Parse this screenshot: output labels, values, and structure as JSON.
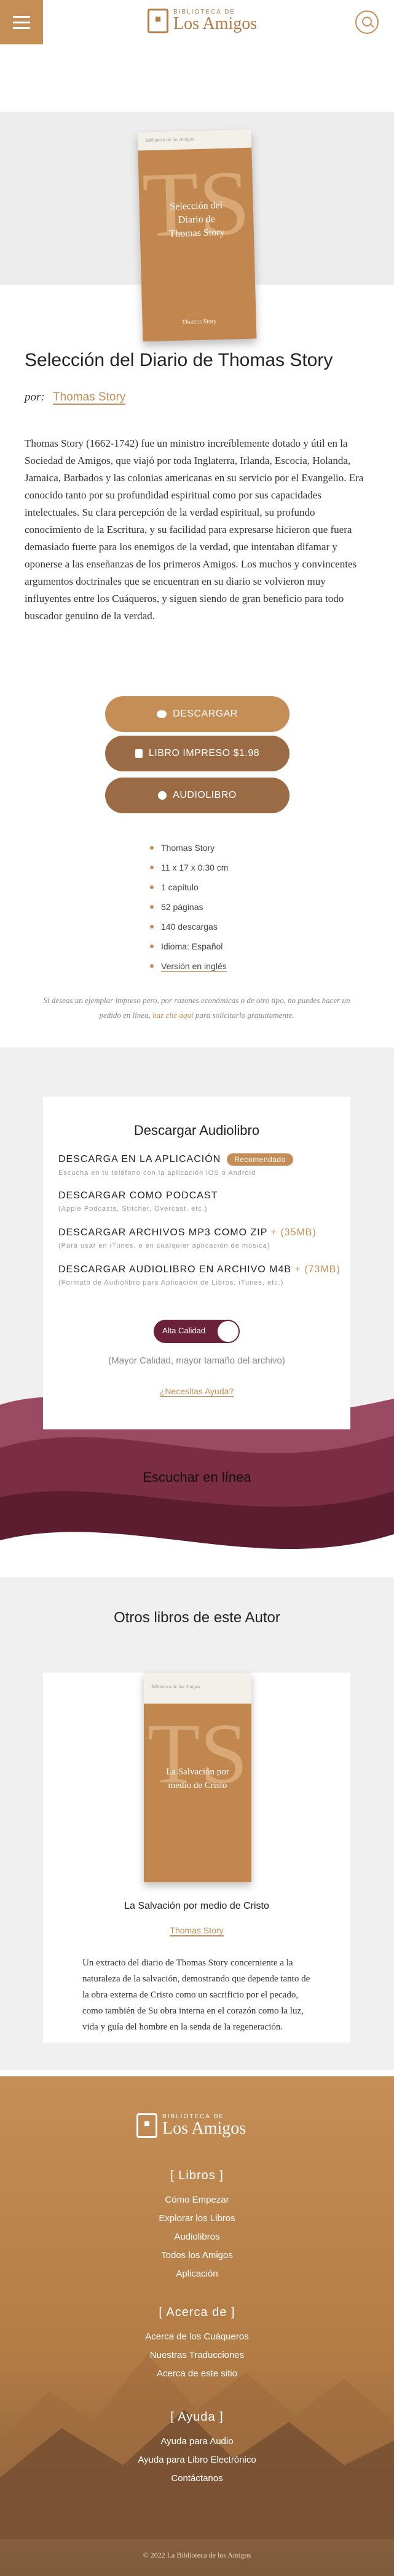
{
  "header": {
    "logo_small": "BIBLIOTECA DE",
    "logo_big": "Los Amigos",
    "menu_icon": "menu-icon",
    "search_icon": "search-icon"
  },
  "cover": {
    "top_label": "Biblioteca de los Amigos",
    "initials": "TS",
    "title_lines": [
      "Selección del",
      "Diario de",
      "Thomas Story"
    ],
    "author": "Thomas Story"
  },
  "book": {
    "title": "Selección del Diario de Thomas Story",
    "por": "por:",
    "author": "Thomas Story",
    "description": "Thomas Story (1662-1742) fue un ministro increíblemente dotado y útil en la Sociedad de Amigos, que viajó por toda Inglaterra, Irlanda, Escocia, Holanda, Jamaica, Barbados y las colonias americanas en su servicio por el Evangelio. Era conocido tanto por su profundidad espiritual como por sus capacidades intelectuales. Su clara percepción de la verdad espiritual, su profundo conocimiento de la Escritura, y su facilidad para expresarse hicieron que fuera demasiado fuerte para los enemigos de la verdad, que intentaban difamar y oponerse a las enseñanzas de los primeros Amigos. Los muchos y convincentes argumentos doctrinales que se encuentran en su diario se volvieron muy influyentes entre los Cuáqueros, y siguen siendo de gran beneficio para todo buscador genuino de la verdad."
  },
  "buttons": {
    "download": "DESCARGAR",
    "print": "LIBRO IMPRESO $1.98",
    "audio": "AUDIOLIBRO"
  },
  "details": [
    "Thomas Story",
    "11 x 17 x 0.30 cm",
    "1 capítulo",
    "52 páginas",
    "140 descargas",
    "Idioma: Español",
    "Versión en inglés"
  ],
  "note": {
    "text_a": "Si deseas un ejemplar impreso pero, por razones económicas o de otro tipo, no puedes hacer un pedido en línea,",
    "link": "haz clic aquí",
    "text_b": "para solicitarlo gratuitamente."
  },
  "audio": {
    "title": "Descargar Audiolibro",
    "options": [
      {
        "label": "DESCARGA EN LA APLICACIÓN",
        "badge": "Recomendado",
        "size": "",
        "sub": "Escucha en tu teléfono con la aplicación iOS o Android"
      },
      {
        "label": "DESCARGAR COMO PODCAST",
        "badge": "",
        "size": "",
        "sub": "(Apple Podcasts, Stitcher, Overcast, etc.)"
      },
      {
        "label": "DESCARGAR ARCHIVOS MP3 COMO ZIP",
        "badge": "",
        "size": "+ (35MB)",
        "sub": "(Para usar en iTunes, o en cualquier aplicación de música)"
      },
      {
        "label": "DESCARGAR AUDIOLIBRO EN ARCHIVO M4B",
        "badge": "",
        "size": "+ (73MB)",
        "sub": "(Formato de Audiolibro para Aplicación de Libros, iTunes, etc.)"
      }
    ],
    "toggle_label": "Alta Calidad",
    "quality_note": "(Mayor Calidad, mayor tamaño del archivo)",
    "help": "¿Necesitas Ayuda?"
  },
  "listen": "Escuchar en línea",
  "other": {
    "title": "La Salvación por medio de Cristo",
    "book_title_lines": [
      "La Salvación por",
      "medio de Cristo"
    ],
    "book_top": "Biblioteca de los Amigos",
    "book_initials": "TS",
    "author": "Thomas Story",
    "description": "Un extracto del diario de Thomas Story concerniente a la naturaleza de la salvación, demostrando que depende tanto de la obra externa de Cristo como un sacrificio por el pecado, como también de Su obra interna en el corazón como la luz, vida y guía del hombre en la senda de la regeneración.",
    "section_title": "Otros libros de este Autor"
  },
  "footer": {
    "logo_small": "BIBLIOTECA DE",
    "logo_big": "Los Amigos",
    "libros_head": "[ Libros ]",
    "libros": [
      "Cómo Empezar",
      "Explorar los Libros",
      "Audiolibros",
      "Todos los Amigos",
      "Aplicación"
    ],
    "acerca_head": "[ Acerca de ]",
    "acerca": [
      "Acerca de los Cuáqueros",
      "Nuestras Traducciones",
      "Acerca de este sitio"
    ],
    "ayuda_head": "[ Ayuda ]",
    "ayuda": [
      "Ayuda para Audio",
      "Ayuda para Libro Electrónico",
      "Contáctanos"
    ],
    "copyright": "© 2022 La Biblioteca de los Amigos"
  }
}
